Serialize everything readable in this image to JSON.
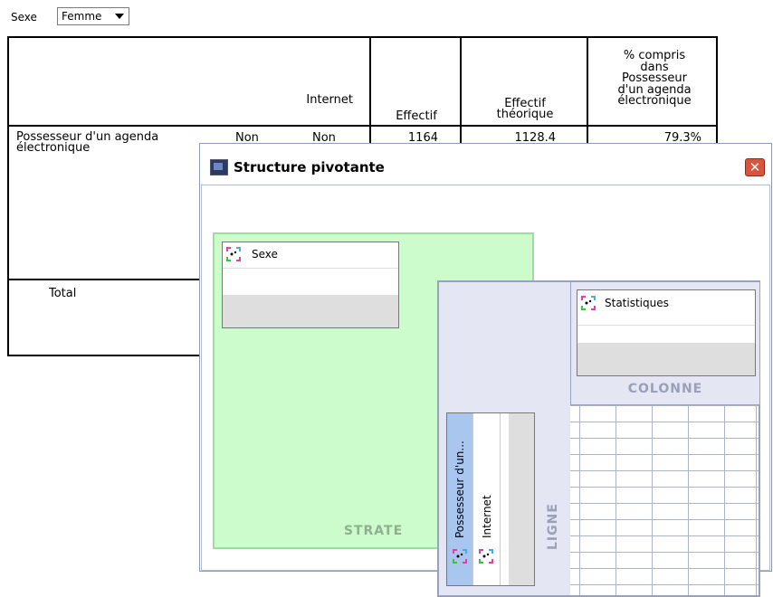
{
  "layer": {
    "label": "Sexe",
    "selected": "Femme"
  },
  "table": {
    "col_header_row_dim": "Internet",
    "col_headers": [
      "Effectif",
      "Effectif\nthéorique",
      "% compris\ndans\nPossesseur\nd'un agenda\nélectronique"
    ],
    "row_group_label": "Possesseur d'un agenda\nélectronique",
    "row1": {
      "sub": "Non",
      "sub2": "Non",
      "effectif": "1164",
      "theorique": "1128.4",
      "pct": "79.3%"
    },
    "total_label": "Total"
  },
  "dialog": {
    "title": "Structure pivotante",
    "close_glyph": "✕",
    "strate_label": "STRATE",
    "colonne_label": "COLONNE",
    "ligne_label": "LIGNE",
    "strate_items": [
      {
        "label": "Sexe",
        "icon": "pivot-dimension-icon"
      }
    ],
    "column_items": [
      {
        "label": "Statistiques",
        "icon": "pivot-dimension-icon"
      }
    ],
    "row_items": [
      {
        "label": "Possesseur d'un...",
        "icon": "pivot-dimension-icon"
      },
      {
        "label": "Internet",
        "icon": "pivot-dimension-icon"
      }
    ]
  },
  "colors": {
    "strate_bg": "#ccfccc",
    "zone_bg": "#e4e6f4",
    "close_button": "#d9533f",
    "selected_row_item": "#a9c6ee"
  }
}
